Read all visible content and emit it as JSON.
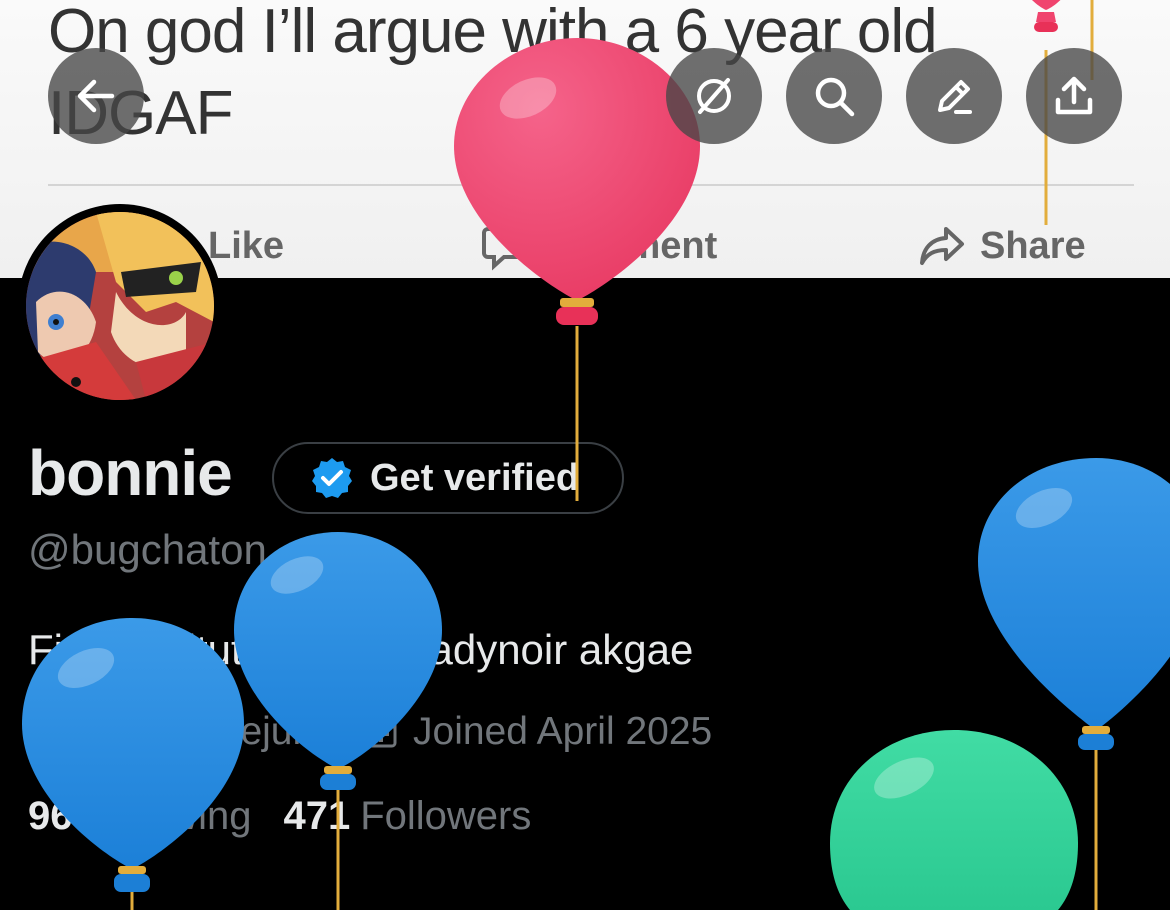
{
  "banner": {
    "post_line1": "On god I’ll argue with a 6 year old",
    "post_line2": "IDGAF",
    "actions": {
      "like": "Like",
      "comment": "Comment",
      "share": "Share"
    }
  },
  "toolbar": {
    "back_icon": "arrow-left-icon",
    "grok_icon": "grok-icon",
    "search_icon": "search-icon",
    "edit_icon": "pencil-icon",
    "share_icon": "upload-icon"
  },
  "profile": {
    "display_name": "bonnie",
    "verify_label": "Get verified",
    "handle": "@bugchaton",
    "bio": "First institutionalized ladynoir akgae",
    "location": "18 pfp ceejurs",
    "joined": "Joined April 2025",
    "following_count": "96",
    "following_label": "Following",
    "followers_count": "471",
    "followers_label": "Followers"
  },
  "colors": {
    "verified_blue": "#1d9bf0",
    "balloon_pink": "#f0446e",
    "balloon_blue": "#1f88e0",
    "balloon_green": "#33d49a"
  }
}
